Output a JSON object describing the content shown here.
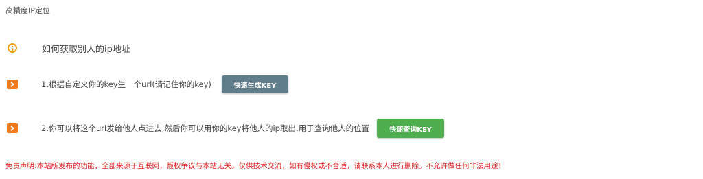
{
  "page": {
    "title": "高精度IP定位"
  },
  "info": {
    "icon": "info-circle-icon",
    "heading": "如何获取别人的ip地址"
  },
  "steps": [
    {
      "icon": "chevron-right-icon",
      "text": "1.根据自定义你的key生一个url(请记住你的key)",
      "button_label": "快速生成KEY"
    },
    {
      "icon": "chevron-right-icon",
      "text": "2.你可以将这个url发给他人点进去,然后你可以用你的key将他人的ip取出,用于查询他人的位置",
      "button_label": "快速查询KEY"
    }
  ],
  "disclaimer": "免责声明:本站所发布的功能，全部来源于互联网，版权争议与本站无关。仅供技术交流，如有侵权或不合适，请联系本人进行删除。不允许做任何非法用途！",
  "colors": {
    "accent_orange": "#f39c12",
    "badge_orange": "#f07a1e",
    "button_gray": "#607d8b",
    "button_green": "#4cae4c",
    "disclaimer_red": "#e02020"
  }
}
